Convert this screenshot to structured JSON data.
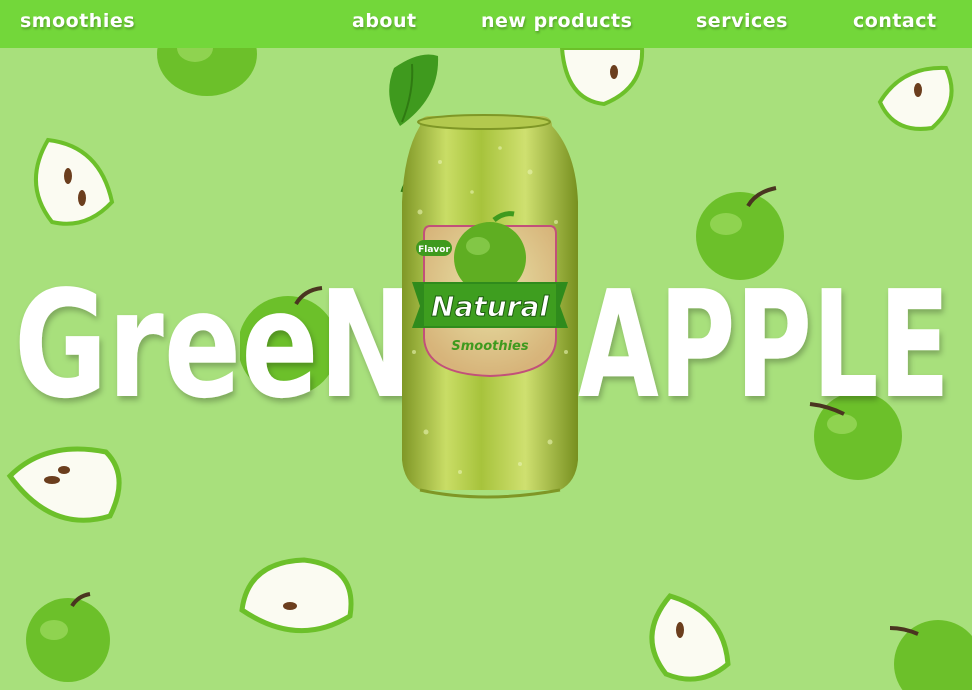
{
  "nav": {
    "brand": "smoothies",
    "links": [
      "about",
      "new products",
      "services",
      "contact"
    ]
  },
  "hero": {
    "title_left": "GreeN",
    "title_right": "APPLE"
  },
  "can": {
    "badge": "Flavor",
    "brand": "Natural",
    "product": "Smoothies"
  },
  "colors": {
    "background": "#a8e07c",
    "nav": "#73d73a",
    "apple": "#6cc02a",
    "can": "#a7c33c"
  }
}
